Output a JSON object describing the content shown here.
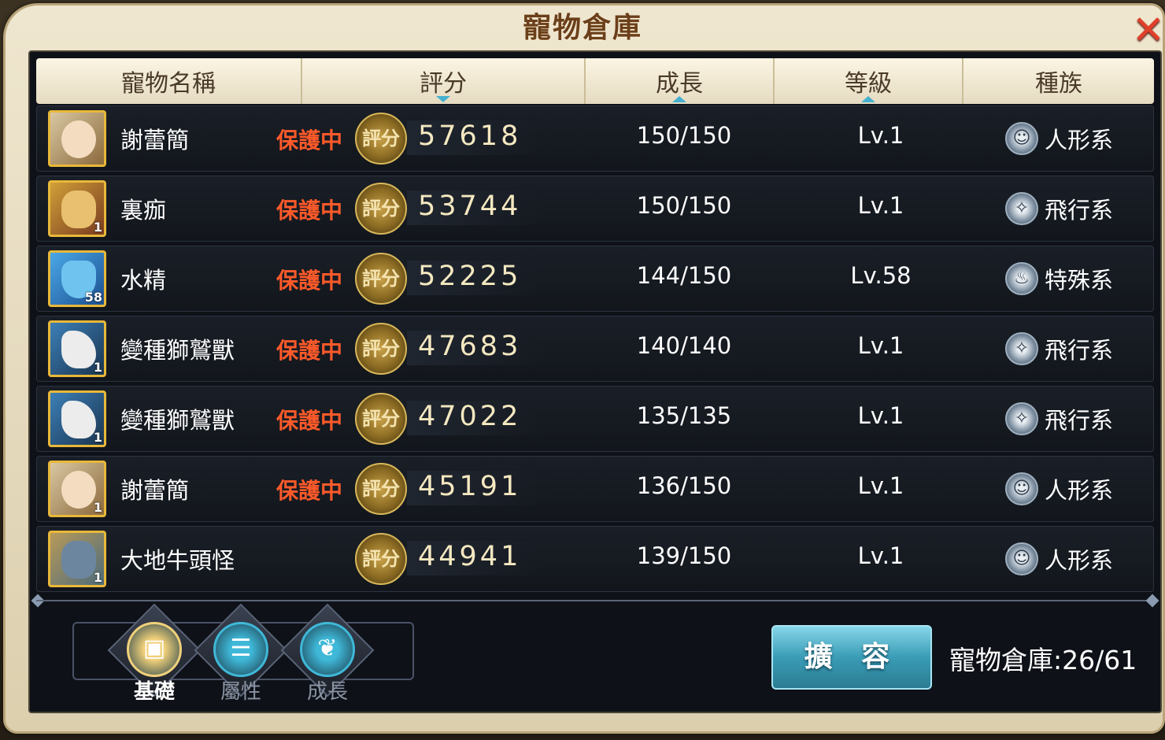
{
  "window": {
    "title": "寵物倉庫",
    "close_icon": "close-icon"
  },
  "columns": [
    {
      "label": "寵物名稱",
      "sort": ""
    },
    {
      "label": "評分",
      "sort": "down"
    },
    {
      "label": "成長",
      "sort": "up"
    },
    {
      "label": "等級",
      "sort": "up"
    },
    {
      "label": "種族",
      "sort": ""
    }
  ],
  "score_badge_label": "評分",
  "pets": [
    {
      "name": "謝蕾簡",
      "protected": "保護中",
      "score": "57618",
      "growth": "150/150",
      "level": "Lv.1",
      "race": "人形系",
      "race_icon": "humanoid-icon",
      "avatar": "girl",
      "avatar_level": ""
    },
    {
      "name": "裏痂",
      "protected": "保護中",
      "score": "53744",
      "growth": "150/150",
      "level": "Lv.1",
      "race": "飛行系",
      "race_icon": "flying-icon",
      "avatar": "gold",
      "avatar_level": "1"
    },
    {
      "name": "水精",
      "protected": "保護中",
      "score": "52225",
      "growth": "144/150",
      "level": "Lv.58",
      "race": "特殊系",
      "race_icon": "special-icon",
      "avatar": "blue",
      "avatar_level": "58"
    },
    {
      "name": "變種獅鷲獸",
      "protected": "保護中",
      "score": "47683",
      "growth": "140/140",
      "level": "Lv.1",
      "race": "飛行系",
      "race_icon": "flying-icon",
      "avatar": "griffin",
      "avatar_level": "1"
    },
    {
      "name": "變種獅鷲獸",
      "protected": "保護中",
      "score": "47022",
      "growth": "135/135",
      "level": "Lv.1",
      "race": "飛行系",
      "race_icon": "flying-icon",
      "avatar": "griffin",
      "avatar_level": "1"
    },
    {
      "name": "謝蕾簡",
      "protected": "保護中",
      "score": "45191",
      "growth": "136/150",
      "level": "Lv.1",
      "race": "人形系",
      "race_icon": "humanoid-icon",
      "avatar": "girl",
      "avatar_level": "1"
    },
    {
      "name": "大地牛頭怪",
      "protected": "",
      "score": "44941",
      "growth": "139/150",
      "level": "Lv.1",
      "race": "人形系",
      "race_icon": "humanoid-icon",
      "avatar": "beast",
      "avatar_level": "1"
    }
  ],
  "tabs": [
    {
      "label": "基礎",
      "icon": "box-icon",
      "active": true,
      "color": "#f0d07a"
    },
    {
      "label": "屬性",
      "icon": "list-icon",
      "active": false,
      "color": "#3fb8d8"
    },
    {
      "label": "成長",
      "icon": "leaf-icon",
      "active": false,
      "color": "#3fb8d8"
    }
  ],
  "expand_button": "擴 容",
  "capacity": "寵物倉庫:26/61",
  "colors": {
    "protect": "#ff5a2a",
    "accent": "#3fb8d8",
    "gold": "#e8b83a"
  }
}
